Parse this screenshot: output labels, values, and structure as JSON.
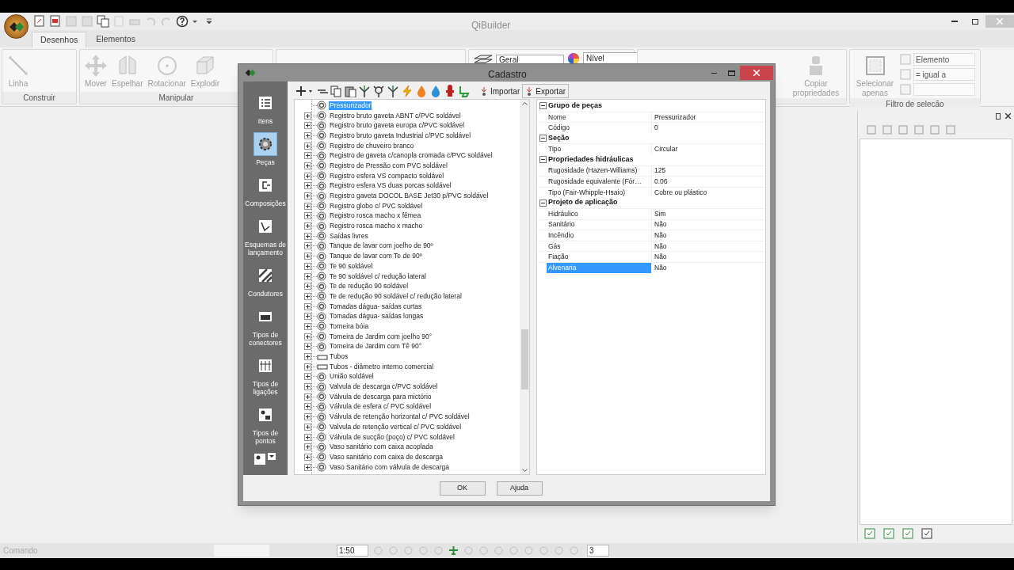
{
  "app": {
    "title": "QiBuilder",
    "tabs": [
      {
        "label": "Desenhos",
        "selected": true
      },
      {
        "label": "Elementos",
        "selected": false
      }
    ]
  },
  "ribbon": {
    "groups": [
      {
        "label": "Construir",
        "buttons": [
          {
            "label": "Linha",
            "disabled": true
          }
        ]
      },
      {
        "label": "Manipular",
        "buttons": [
          {
            "label": "Mover",
            "disabled": true
          },
          {
            "label": "Espelhar",
            "disabled": true
          },
          {
            "label": "Rotacionar",
            "disabled": true
          },
          {
            "label": "Explodir",
            "disabled": true
          }
        ]
      },
      {
        "dropdowns": [
          "Geral",
          "Nível"
        ]
      },
      {
        "buttons": [
          {
            "label": "Copiar propriedades",
            "disabled": true
          }
        ]
      },
      {
        "label": "Filtro de seleção",
        "buttons": [
          {
            "label": "Selecionar apenas",
            "disabled": true
          }
        ],
        "filters": [
          "Elemento",
          "= igual a"
        ]
      }
    ]
  },
  "dialog": {
    "title": "Cadastro",
    "sidebar": [
      {
        "label": "Itens",
        "selected": false
      },
      {
        "label": "Peças",
        "selected": true
      },
      {
        "label": "Composições",
        "selected": false
      },
      {
        "label": "Esquemas de lançamento",
        "selected": false
      },
      {
        "label": "Condutores",
        "selected": false
      },
      {
        "label": "Tipos de conectores",
        "selected": false
      },
      {
        "label": "Tipos de ligações",
        "selected": false
      },
      {
        "label": "Tipos de pontos",
        "selected": false
      }
    ],
    "toolbar": [
      {
        "kind": "add"
      },
      {
        "kind": "remove"
      },
      {
        "kind": "copy"
      },
      {
        "kind": "paste"
      },
      {
        "kind": "pipe"
      },
      {
        "kind": "valve"
      },
      {
        "kind": "pipe"
      },
      {
        "kind": "bolt"
      },
      {
        "kind": "flame"
      },
      {
        "kind": "drop"
      },
      {
        "kind": "hydrant"
      },
      {
        "kind": "toilet"
      },
      {
        "kind": "text",
        "label": "Importar"
      },
      {
        "kind": "text",
        "label": "Exportar"
      }
    ],
    "tree": [
      {
        "label": "Pressurizador",
        "kind": "fitting",
        "expandable": false,
        "selected": true
      },
      {
        "label": "Registro bruto gaveta ABNT c/PVC soldável",
        "kind": "fitting",
        "expandable": true,
        "selected": false
      },
      {
        "label": "Registro bruto gaveta europa c/PVC soldável",
        "kind": "fitting",
        "expandable": true,
        "selected": false
      },
      {
        "label": "Registro bruto gaveta Industrial  c/PVC soldável",
        "kind": "fitting",
        "expandable": true,
        "selected": false
      },
      {
        "label": "Registro de chuveiro branco",
        "kind": "fitting",
        "expandable": true,
        "selected": false
      },
      {
        "label": "Registro de gaveta c/canopla cromada c/PVC soldável",
        "kind": "fitting",
        "expandable": true,
        "selected": false
      },
      {
        "label": "Registro de Pressão com PVC soldável",
        "kind": "fitting",
        "expandable": true,
        "selected": false
      },
      {
        "label": "Registro esfera VS compacto soldável",
        "kind": "fitting",
        "expandable": true,
        "selected": false
      },
      {
        "label": "Registro esfera VS duas porcas soldável",
        "kind": "fitting",
        "expandable": true,
        "selected": false
      },
      {
        "label": "Registro gaveta DOCOL BASE Jet30 p/PVC soldável",
        "kind": "fitting",
        "expandable": true,
        "selected": false
      },
      {
        "label": "Registro globo c/ PVC soldável",
        "kind": "fitting",
        "expandable": true,
        "selected": false
      },
      {
        "label": "Registro rosca macho x fêmea",
        "kind": "fitting",
        "expandable": true,
        "selected": false
      },
      {
        "label": "Registro rosca macho x macho",
        "kind": "fitting",
        "expandable": true,
        "selected": false
      },
      {
        "label": "Saídas livres",
        "kind": "fitting",
        "expandable": true,
        "selected": false
      },
      {
        "label": "Tanque de lavar com joelho de 90º",
        "kind": "fitting",
        "expandable": true,
        "selected": false
      },
      {
        "label": "Tanque de lavar com Te de 90º",
        "kind": "fitting",
        "expandable": true,
        "selected": false
      },
      {
        "label": "Te 90 soldável",
        "kind": "fitting",
        "expandable": true,
        "selected": false
      },
      {
        "label": "Te 90 soldável c/ redução lateral",
        "kind": "fitting",
        "expandable": true,
        "selected": false
      },
      {
        "label": "Te de redução 90 soldável",
        "kind": "fitting",
        "expandable": true,
        "selected": false
      },
      {
        "label": "Te de redução 90 soldável c/ redução lateral",
        "kind": "fitting",
        "expandable": true,
        "selected": false
      },
      {
        "label": "Tomadas dágua- saídas curtas",
        "kind": "fitting",
        "expandable": true,
        "selected": false
      },
      {
        "label": "Tomadas dágua- saídas longas",
        "kind": "fitting",
        "expandable": true,
        "selected": false
      },
      {
        "label": "Torneira bóia",
        "kind": "fitting",
        "expandable": true,
        "selected": false
      },
      {
        "label": "Torneira de Jardim com joelho 90°",
        "kind": "fitting",
        "expandable": true,
        "selected": false
      },
      {
        "label": "Torneira de Jardim com Tê 90°",
        "kind": "fitting",
        "expandable": true,
        "selected": false
      },
      {
        "label": "Tubos",
        "kind": "tube",
        "expandable": true,
        "selected": false
      },
      {
        "label": "Tubos - diâmetro interno comercial",
        "kind": "tube",
        "expandable": true,
        "selected": false
      },
      {
        "label": "União soldável",
        "kind": "fitting",
        "expandable": true,
        "selected": false
      },
      {
        "label": "Valvula de descarga c/PVC  soldável",
        "kind": "fitting",
        "expandable": true,
        "selected": false
      },
      {
        "label": "Válvula de descarga para mictório",
        "kind": "fitting",
        "expandable": true,
        "selected": false
      },
      {
        "label": "Válvula de esfera  c/ PVC soldável",
        "kind": "fitting",
        "expandable": true,
        "selected": false
      },
      {
        "label": "Válvula de retenção horizontal c/ PVC soldável",
        "kind": "fitting",
        "expandable": true,
        "selected": false
      },
      {
        "label": "Valvula de retenção vertical c/ PVC soldável",
        "kind": "fitting",
        "expandable": true,
        "selected": false
      },
      {
        "label": "Válvula de sucção (poço) c/ PVC soldável",
        "kind": "fitting",
        "expandable": true,
        "selected": false
      },
      {
        "label": "Vaso sanitário com caixa acoplada",
        "kind": "fitting",
        "expandable": true,
        "selected": false
      },
      {
        "label": "Vaso sanitário com caixa de descarga",
        "kind": "fitting",
        "expandable": true,
        "selected": false
      },
      {
        "label": "Vaso Sanitário com válvula de descarga",
        "kind": "fitting",
        "expandable": true,
        "selected": false
      }
    ],
    "properties": [
      {
        "category": "Grupo de peças",
        "expanded": true,
        "rows": [
          {
            "name": "Nome",
            "value": "Pressurizador",
            "selected": false
          },
          {
            "name": "Código",
            "value": "0",
            "selected": false
          }
        ]
      },
      {
        "category": "Seção",
        "expanded": true,
        "rows": [
          {
            "name": "Tipo",
            "value": "Circular",
            "selected": false
          }
        ]
      },
      {
        "category": "Propriedades hidráulicas",
        "expanded": true,
        "rows": [
          {
            "name": "Rugosidade (Hazen-Williams)",
            "value": "125",
            "selected": false
          },
          {
            "name": "Rugosidade equivalente (Fór…",
            "value": "0.06",
            "selected": false
          },
          {
            "name": "Tipo (Fair-Whipple-Hsaio)",
            "value": "Cobre ou plástico",
            "selected": false
          }
        ]
      },
      {
        "category": "Projeto de aplicação",
        "expanded": true,
        "rows": [
          {
            "name": "Hidráulico",
            "value": "Sim",
            "selected": false
          },
          {
            "name": "Sanitário",
            "value": "Não",
            "selected": false
          },
          {
            "name": "Incêndio",
            "value": "Não",
            "selected": false
          },
          {
            "name": "Gás",
            "value": "Não",
            "selected": false
          },
          {
            "name": "Fiação",
            "value": "Não",
            "selected": false
          },
          {
            "name": "Alvenaria",
            "value": "Não",
            "selected": true
          }
        ]
      }
    ],
    "buttons": [
      "OK",
      "Ajuda"
    ]
  },
  "status_bar": {
    "command_placeholder": "Comando",
    "scale": "1:50",
    "spinner": "3"
  }
}
